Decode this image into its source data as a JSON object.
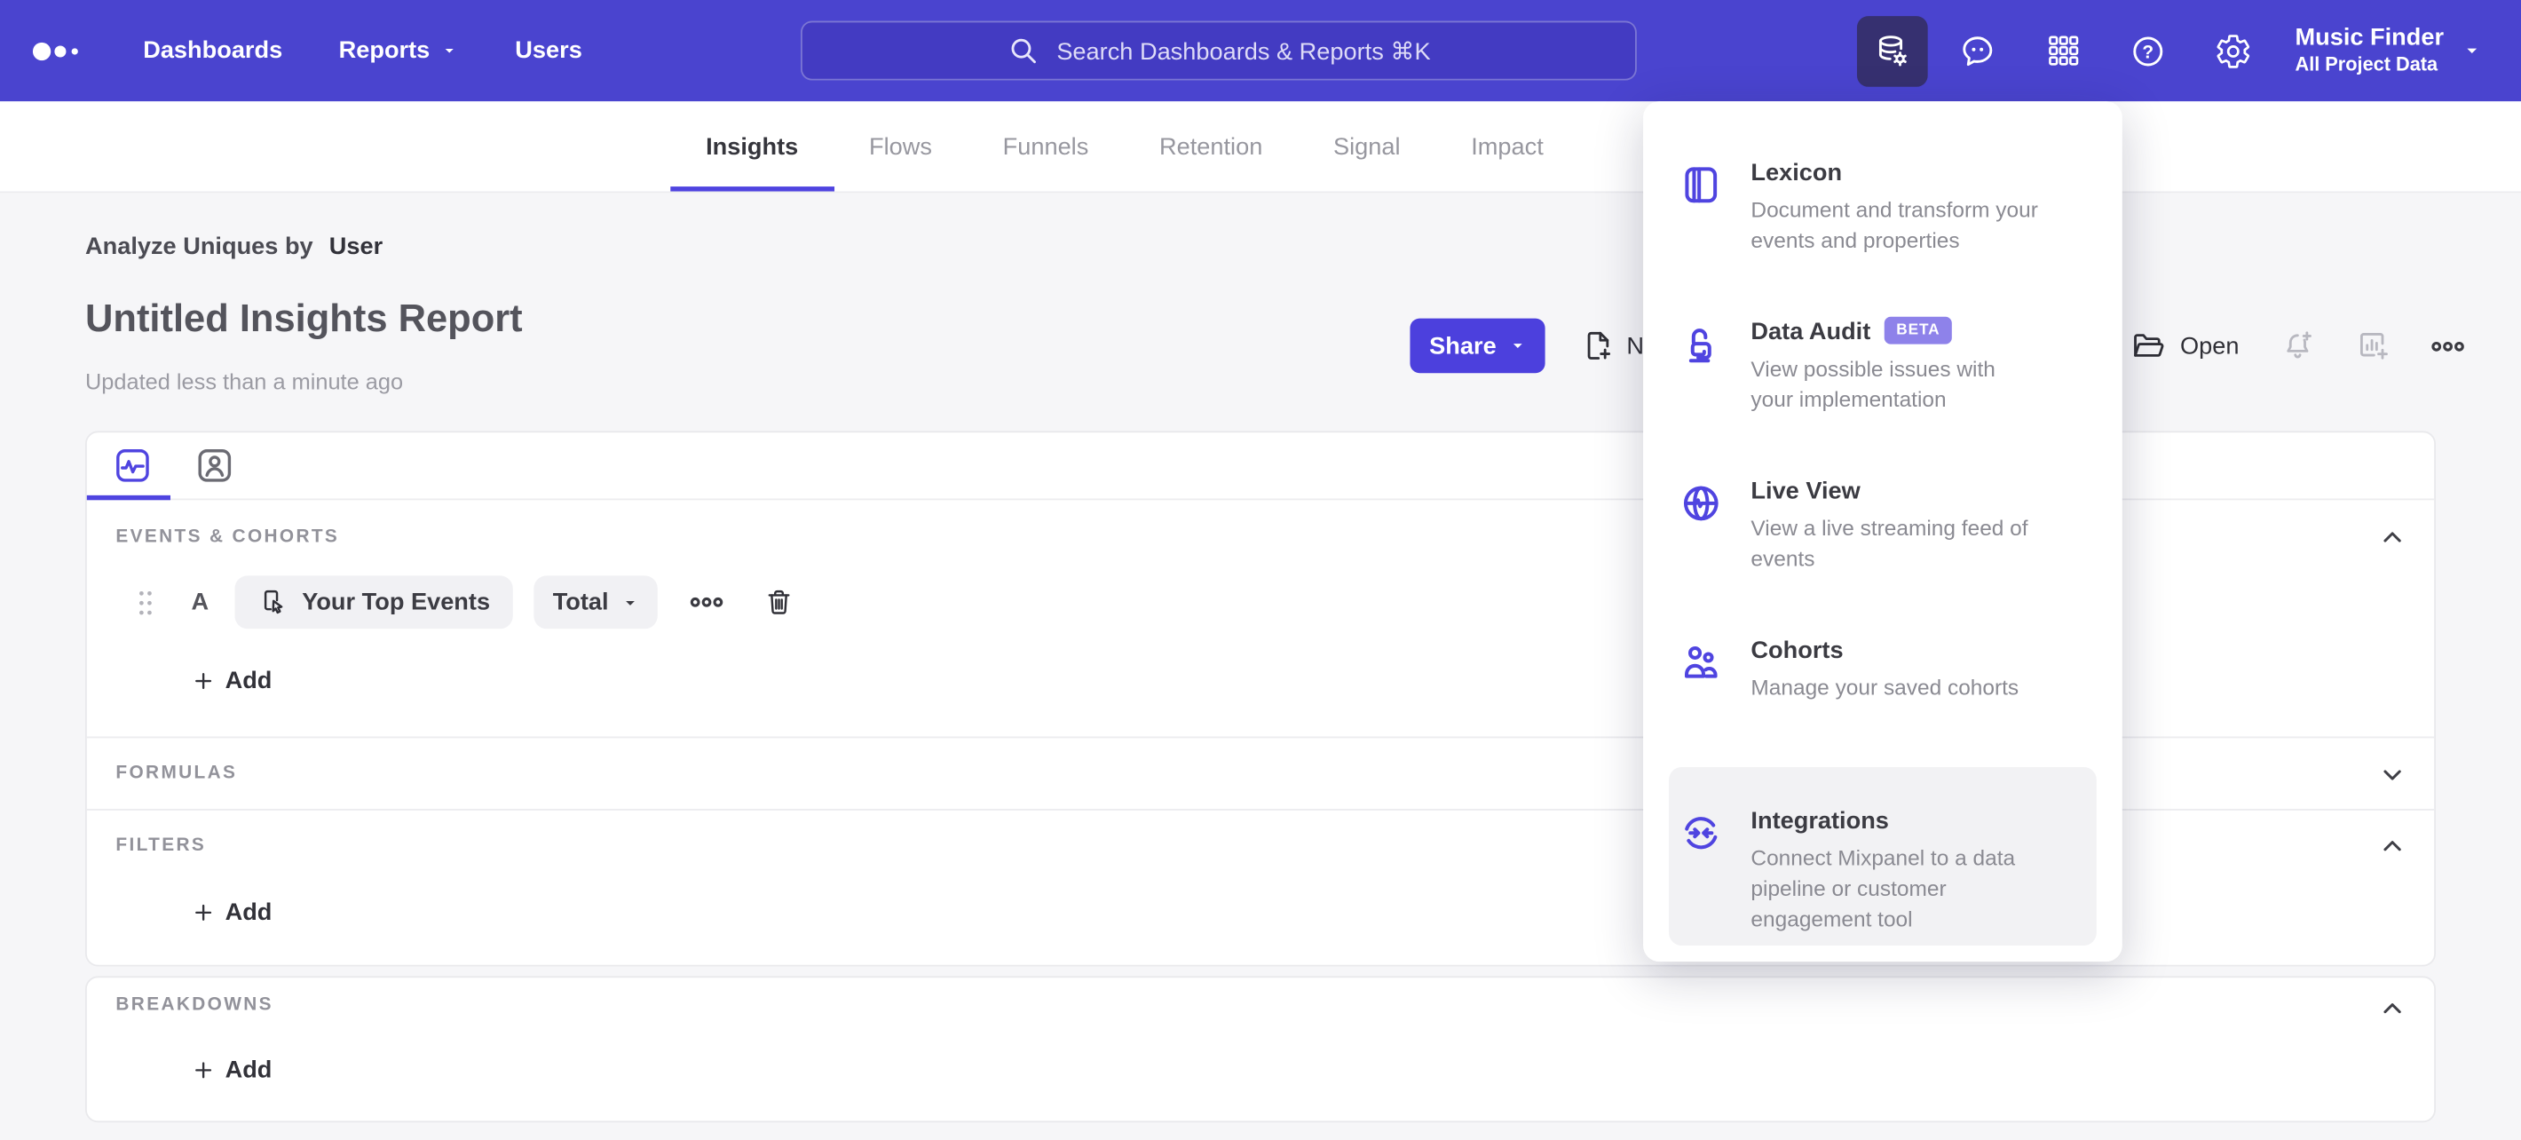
{
  "brand": {
    "accent": "#4f44e0",
    "nav_background": "#4a44cf",
    "active_icon_background": "#363070",
    "badge_background": "#8e82ea"
  },
  "nav": {
    "items": [
      "Dashboards",
      "Reports",
      "Users"
    ],
    "search_placeholder": "Search Dashboards & Reports ⌘K",
    "project_name": "Music Finder",
    "project_scope": "All Project Data"
  },
  "tabs": [
    "Insights",
    "Flows",
    "Funnels",
    "Retention",
    "Signal",
    "Impact"
  ],
  "report": {
    "analyze_label": "Analyze Uniques by",
    "analyze_value": "User",
    "title": "Untitled Insights Report",
    "updated": "Updated less than a minute ago",
    "share_label": "Share",
    "new_label": "New",
    "open_label": "Open"
  },
  "builder": {
    "events": {
      "label": "EVENTS & COHORTS",
      "row_letter": "A",
      "event_name": "Your Top Events",
      "metric": "Total",
      "add_label": "Add"
    },
    "formulas": {
      "label": "FORMULAS"
    },
    "filters": {
      "label": "FILTERS",
      "add_label": "Add"
    },
    "breakdowns": {
      "label": "BREAKDOWNS",
      "add_label": "Add"
    }
  },
  "menu": {
    "items": [
      {
        "title": "Lexicon",
        "desc": "Document and transform your events and properties"
      },
      {
        "title": "Data Audit",
        "badge": "BETA",
        "desc": "View possible issues with your implementation"
      },
      {
        "title": "Live View",
        "desc": "View a live streaming feed of events"
      },
      {
        "title": "Cohorts",
        "desc": "Manage your saved cohorts"
      },
      {
        "title": "Integrations",
        "desc": "Connect Mixpanel to a data pipeline or customer engagement tool"
      }
    ]
  }
}
